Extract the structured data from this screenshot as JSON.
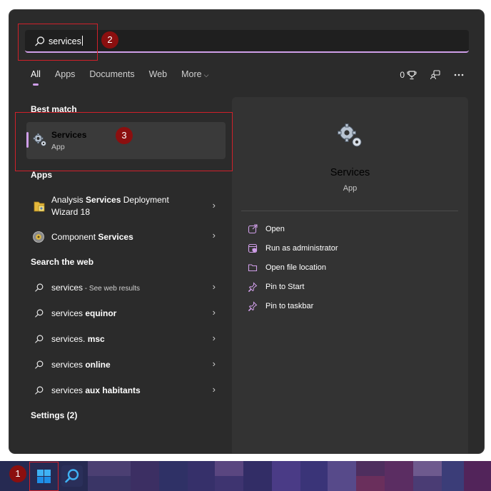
{
  "search": {
    "query": "services"
  },
  "tabs": {
    "all": "All",
    "apps": "Apps",
    "documents": "Documents",
    "web": "Web",
    "more": "More"
  },
  "toolbar": {
    "points": "0"
  },
  "best_match": {
    "header": "Best match",
    "title": "Services",
    "subtitle": "App",
    "icon": "gears-icon"
  },
  "apps": {
    "header": "Apps",
    "items": [
      {
        "prefix": "Analysis ",
        "highlight": "Services",
        "suffix": " Deployment",
        "line2": "Wizard 18"
      },
      {
        "prefix": "Component ",
        "highlight": "Services",
        "suffix": "",
        "line2": ""
      }
    ]
  },
  "web": {
    "header": "Search the web",
    "items": [
      {
        "prefix": "services",
        "highlight": "",
        "note": " - See web results"
      },
      {
        "prefix": "services ",
        "highlight": "equinor",
        "note": ""
      },
      {
        "prefix": "services. ",
        "highlight": "msc",
        "note": ""
      },
      {
        "prefix": "services ",
        "highlight": "online",
        "note": ""
      },
      {
        "prefix": "services ",
        "highlight": "aux habitants",
        "note": ""
      }
    ]
  },
  "settings": {
    "header": "Settings (2)"
  },
  "preview": {
    "title": "Services",
    "subtitle": "App",
    "actions": [
      {
        "label": "Open",
        "icon": "open-external-icon"
      },
      {
        "label": "Run as administrator",
        "icon": "shield-admin-icon"
      },
      {
        "label": "Open file location",
        "icon": "folder-icon"
      },
      {
        "label": "Pin to Start",
        "icon": "pin-icon"
      },
      {
        "label": "Pin to taskbar",
        "icon": "pin-icon"
      }
    ]
  },
  "annotations": [
    "1",
    "2",
    "3"
  ],
  "colors": {
    "accent": "#cf9ee8",
    "panel": "#2b2b2b",
    "annotation": "#d0202a",
    "annotation_badge": "#8b0f0f"
  }
}
